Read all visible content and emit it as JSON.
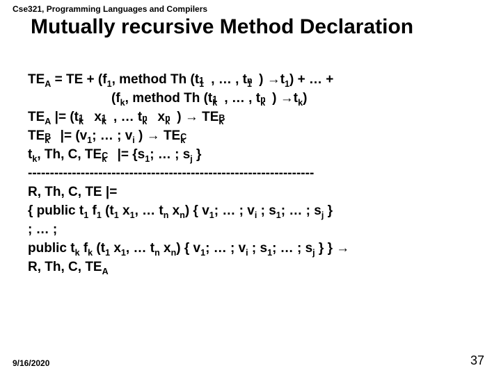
{
  "course": "Cse321, Programming Languages and Compilers",
  "title": "Mutually recursive Method Declaration",
  "footer": {
    "date": "9/16/2020",
    "page": "37"
  },
  "lines": {
    "l1_pre": "TE",
    "l1_a": "A",
    "l1_post": " = TE + (f",
    "l1_sub1": "1",
    "l1_b": ", method Th (t",
    "l1_c": ", … , t",
    "l1_d": ") →t",
    "l1_e": ") + … +",
    "l2_a": "(f",
    "l2_k": "k",
    "l2_b": ", method Th (t",
    "l2_c": ", … , t",
    "l2_d": ") →t",
    "l2_e": ")",
    "l3_pre": "TE",
    "l3_a": "A",
    "l3_b": " |= (t",
    "l3_c": " x",
    "l3_d": ", … t",
    "l3_e": " x",
    "l3_f": ") → TE",
    "l3_B": "B",
    "l4_pre": "TE",
    "l4_B": "B",
    "l4_k": "k",
    "l4_a": " |= (v",
    "l4_v1": "1",
    "l4_b": "; … ; v",
    "l4_vi": "i",
    "l4_c": " ) → TE",
    "l4_C": "C",
    "l5_a": "t",
    "l5_k": "k",
    "l5_b": ", Th, C, TE",
    "l5_C": "C",
    "l5_c": " |=  {s",
    "l5_s1": "1",
    "l5_d": "; … ; s",
    "l5_sj": "j",
    "l5_e": " }",
    "divider": "-----------------------------------------------------------------",
    "l7": "R, Th, C, TE   |=",
    "l8_a": "{ public t",
    "l8_1": "1",
    "l8_b": " f",
    "l8_c": " (t",
    "l8_d": " x",
    "l8_e": ", … t",
    "l8_n": "n",
    "l8_f": " x",
    "l8_g": ") { v",
    "l8_h": "; … ; v",
    "l8_i": "i",
    "l8_j": " ; s",
    "l8_k": "; … ; s",
    "l8_l": "j",
    "l8_m": " }",
    "l9": "; … ;",
    "l10_a": "public t",
    "l10_k": "k",
    "l10_b": " f",
    "l10_c": " (t",
    "l10_1": "1",
    "l10_d": " x",
    "l10_e": ", … t",
    "l10_n": "n",
    "l10_f": " x",
    "l10_g": ") { v",
    "l10_h": "; … ; v",
    "l10_i": "i",
    "l10_j": " ; s",
    "l10_k2": "; … ; s",
    "l10_l": "j",
    "l10_m": " }  } →",
    "l11_a": "R, Th, C, TE",
    "l11_A": "A"
  }
}
